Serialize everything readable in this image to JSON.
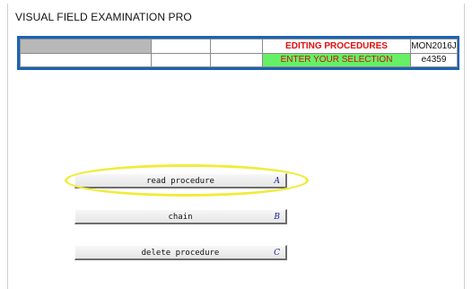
{
  "app": {
    "title": "VISUAL FIELD EXAMINATION PRO"
  },
  "status_bar": {
    "mode": "EDITING PROCEDURES",
    "prompt": "ENTER YOUR SELECTION",
    "code_top": "MON2016J",
    "code_bottom": "e4359"
  },
  "menu": [
    {
      "label": "read procedure",
      "key": "A"
    },
    {
      "label": "chain",
      "key": "B"
    },
    {
      "label": "delete procedure",
      "key": "C"
    }
  ],
  "colors": {
    "frame": "#1a64b4",
    "mode_text": "#e01010",
    "prompt_bg": "#66f066",
    "highlight": "#f0ec3a"
  }
}
